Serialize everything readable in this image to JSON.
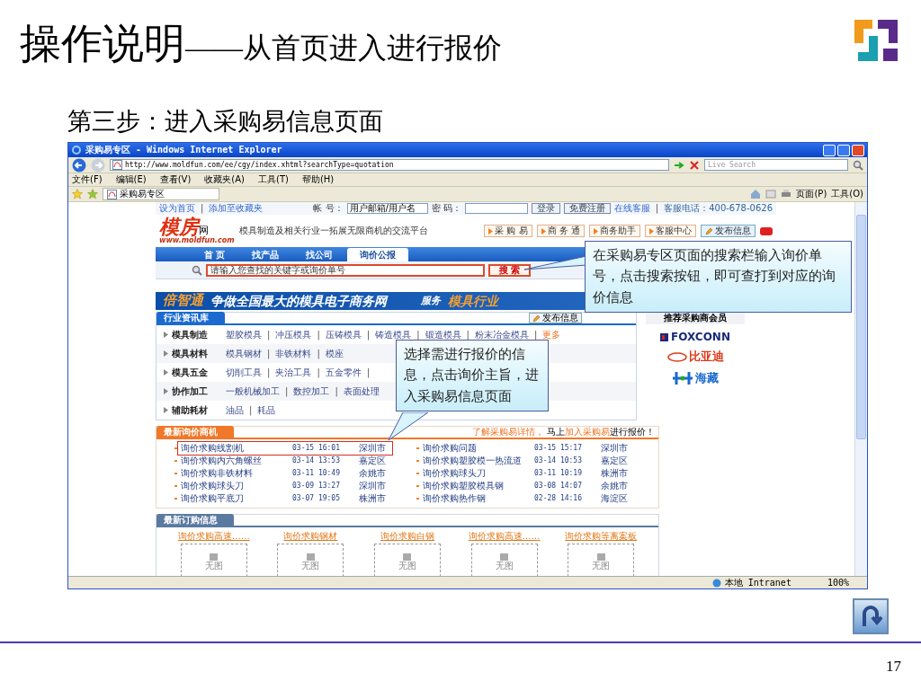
{
  "slide": {
    "title": "操作说明",
    "title_suffix": "——从首页进入进行报价",
    "subtitle": "第三步：进入采购易信息页面",
    "page_number": "17"
  },
  "browser": {
    "title": "采购易专区 - Windows Internet Explorer",
    "address": "http://www.moldfun.com/ee/cgy/index.xhtml?searchType=quotation",
    "search_placeholder": "Live Search",
    "menu": [
      "文件(F)",
      "编辑(E)",
      "查看(V)",
      "收藏夹(A)",
      "工具(T)",
      "帮助(H)"
    ],
    "tab": "采购易专区",
    "toolbar": [
      "页面(P)",
      "工具(O)"
    ],
    "status_zone": "本地 Intranet",
    "zoom": "100%"
  },
  "site": {
    "top_links": [
      "设为首页",
      "|",
      "添加至收藏夹"
    ],
    "login": {
      "account_label": "帐 号：",
      "account_value": "用户邮箱/用户名",
      "password_label": "密 码：",
      "buttons": [
        "登录",
        "免费注册"
      ]
    },
    "service": [
      "在线客服",
      "|",
      "客服电话：400-678-0626"
    ],
    "logo": {
      "name": "模房",
      "suffix": "网",
      "url": "www.moldfun.com"
    },
    "slogan": "模具制造及相关行业一拓展无限商机的交流平台",
    "quick_buttons": [
      {
        "label": "采 购 易",
        "kind": "link"
      },
      {
        "label": "商 务 通",
        "kind": "link"
      },
      {
        "label": "商务助手",
        "kind": "link"
      },
      {
        "label": "客服中心",
        "kind": "link"
      },
      {
        "label": "发布信息",
        "kind": "post"
      }
    ],
    "nav": [
      {
        "label": "首 页",
        "selected": false
      },
      {
        "label": "找产品",
        "selected": false
      },
      {
        "label": "找公司",
        "selected": false
      },
      {
        "label": "询价公报",
        "selected": true
      }
    ],
    "search": {
      "placeholder": "请输入您查找的关键字或询价单号",
      "button": "搜 索"
    },
    "banner": {
      "brand": "倍智通",
      "text": "争做全国最大的模具电子商务网",
      "service": "服务",
      "industry": "模具行业"
    },
    "industry": {
      "title": "行业资讯库",
      "post_button": "发布信息",
      "categories": [
        {
          "name": "模具制造",
          "items": [
            "塑胶模具",
            "|",
            "冲压模具",
            "|",
            "压铸模具",
            "|",
            "铸造模具",
            "|",
            "锻造模具",
            "|",
            "粉末冶金模具",
            "|"
          ],
          "more": "更多"
        },
        {
          "name": "模具材料",
          "items": [
            "模具钢材",
            "|",
            "非铁材料",
            "|",
            "模座"
          ]
        },
        {
          "name": "模具五金",
          "items": [
            "切削工具",
            "|",
            "夹治工具",
            "|",
            "五金零件",
            "|"
          ]
        },
        {
          "name": "协作加工",
          "items": [
            "一般机械加工",
            "|",
            "数控加工",
            "|",
            "表面处理"
          ]
        },
        {
          "name": "辅助耗材",
          "items": [
            "油品",
            "|",
            "耗品"
          ]
        }
      ]
    },
    "members": {
      "title": "推荐采购商会员",
      "logos": [
        {
          "kind": "foxconn",
          "text": "FOXCONN"
        },
        {
          "kind": "byd",
          "text": "比亚迪"
        },
        {
          "kind": "haizang",
          "text": "海藏"
        }
      ]
    },
    "quotes": {
      "title": "最新询价商机",
      "learn_more": "了解采购易详情，",
      "join_prefix": "马上",
      "join_link": "加入采购易",
      "join_suffix": "进行报价！",
      "columns": [
        [
          {
            "name": "询价求购线割机",
            "time": "03-15 16:01",
            "place": "深圳市"
          },
          {
            "name": "询价求购内六角螺丝",
            "time": "03-14 13:53",
            "place": "嘉定区"
          },
          {
            "name": "询价求购非铁材料",
            "time": "03-11 10:49",
            "place": "余姚市"
          },
          {
            "name": "询价求购球头刀",
            "time": "03-09 13:27",
            "place": "深圳市"
          },
          {
            "name": "询价求购平底刀",
            "time": "03-07 19:05",
            "place": "株洲市"
          }
        ],
        [
          {
            "name": "询价求购问题",
            "time": "03-15 15:17",
            "place": "深圳市"
          },
          {
            "name": "询价求购塑胶模一热流道",
            "time": "03-14 10:53",
            "place": "嘉定区"
          },
          {
            "name": "询价求购球头刀",
            "time": "03-11 10:19",
            "place": "株洲市"
          },
          {
            "name": "询价求购塑胶模具钢",
            "time": "03-08 14:07",
            "place": "余姚市"
          },
          {
            "name": "询价求购热作钢",
            "time": "02-28 14:16",
            "place": "海淀区"
          }
        ]
      ]
    },
    "orders": {
      "title": "最新订购信息",
      "items": [
        {
          "title": "询价求购高速……",
          "image": "无图"
        },
        {
          "title": "询价求购钢材",
          "image": "无图"
        },
        {
          "title": "询价求购白钢",
          "image": "无图"
        },
        {
          "title": "询价求购高速……",
          "image": "无图"
        },
        {
          "title": "询价求购等离案板",
          "image": "无图"
        }
      ]
    }
  },
  "callouts": [
    {
      "text": "在采购易专区页面的搜索栏输入询价单号，点击搜索按钮，即可查打到对应的询价信息"
    },
    {
      "text": "选择需进行报价的信息，点击询价主旨，进入采购易信息页面"
    }
  ]
}
